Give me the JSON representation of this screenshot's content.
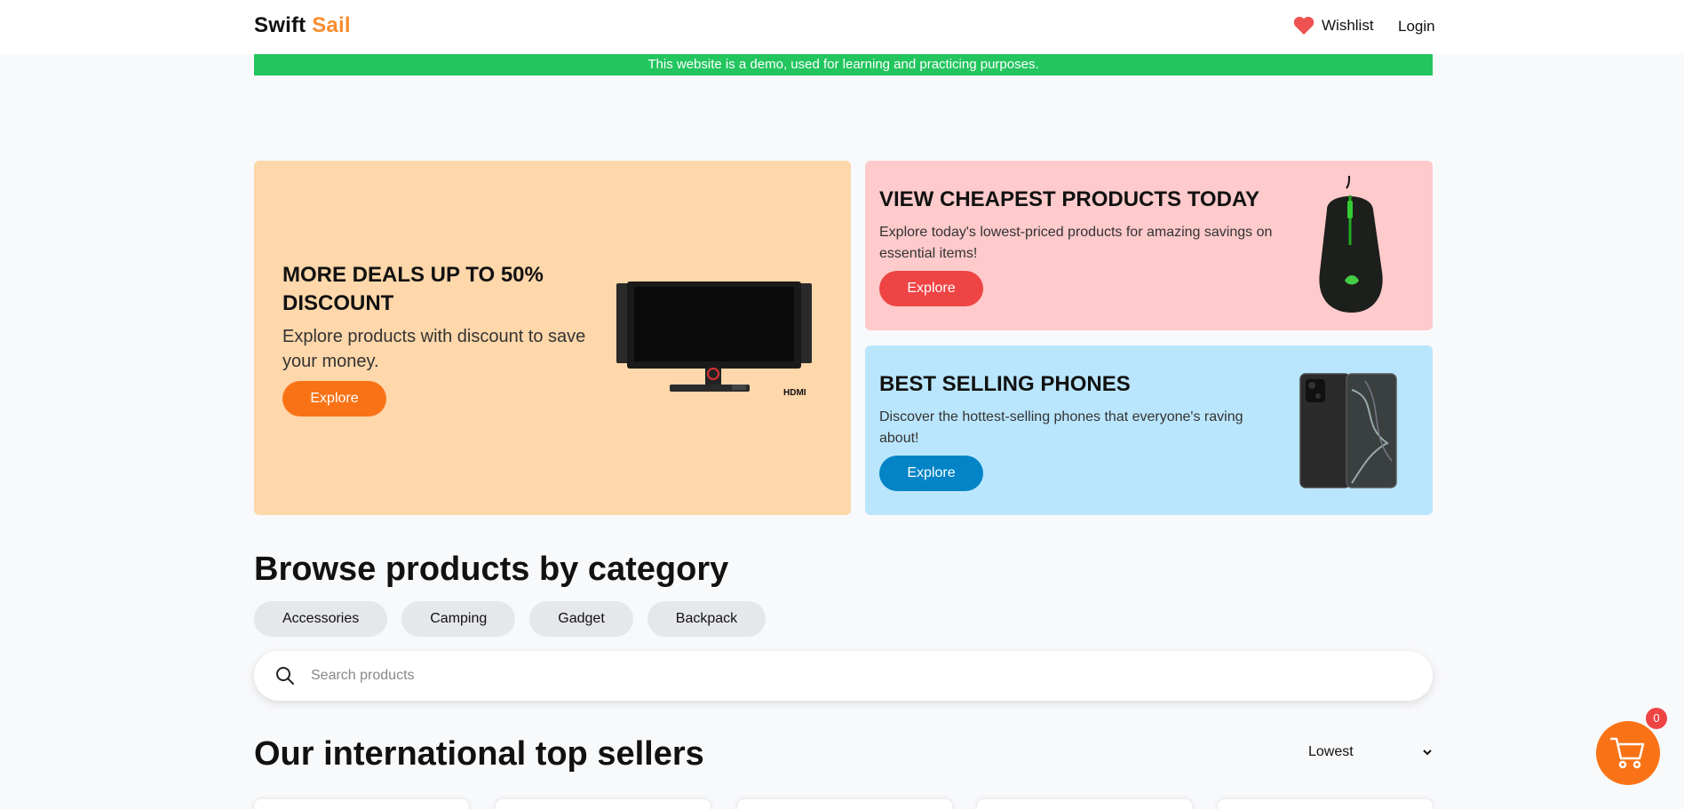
{
  "header": {
    "brand_part1": "Swift",
    "brand_part2": "Sail",
    "wishlist_label": "Wishlist",
    "login_label": "Login",
    "wishlist_icon": "heart-icon"
  },
  "banner": {
    "text": "This website is a demo, used for learning and practicing purposes."
  },
  "promos": [
    {
      "title": "MORE DEALS UP TO 50% DISCOUNT",
      "description": "Explore products with discount to save your money.",
      "button": "Explore",
      "image": "monitor-image"
    },
    {
      "title": "VIEW CHEAPEST PRODUCTS TODAY",
      "description": "Explore today's lowest-priced products for amazing savings on essential items!",
      "button": "Explore",
      "image": "gaming-mouse-image"
    },
    {
      "title": "BEST SELLING PHONES",
      "description": "Discover the hottest-selling phones that everyone's raving about!",
      "button": "Explore",
      "image": "smartphone-image"
    }
  ],
  "browse": {
    "title": "Browse products by category",
    "categories": [
      "Accessories",
      "Camping",
      "Gadget",
      "Backpack"
    ]
  },
  "search": {
    "placeholder": "Search products",
    "value": ""
  },
  "sellers": {
    "title": "Our international top sellers",
    "sort_selected": "Lowest"
  },
  "cart": {
    "count": "0"
  },
  "colors": {
    "brand_accent": "#f98d2d",
    "banner_green": "#22c55e",
    "promo_orange": "#fed7aa",
    "promo_pink": "#fecacb",
    "promo_blue": "#bae6fd",
    "button_orange": "#f97316",
    "button_red": "#ef4444",
    "button_blue": "#0284c7"
  }
}
